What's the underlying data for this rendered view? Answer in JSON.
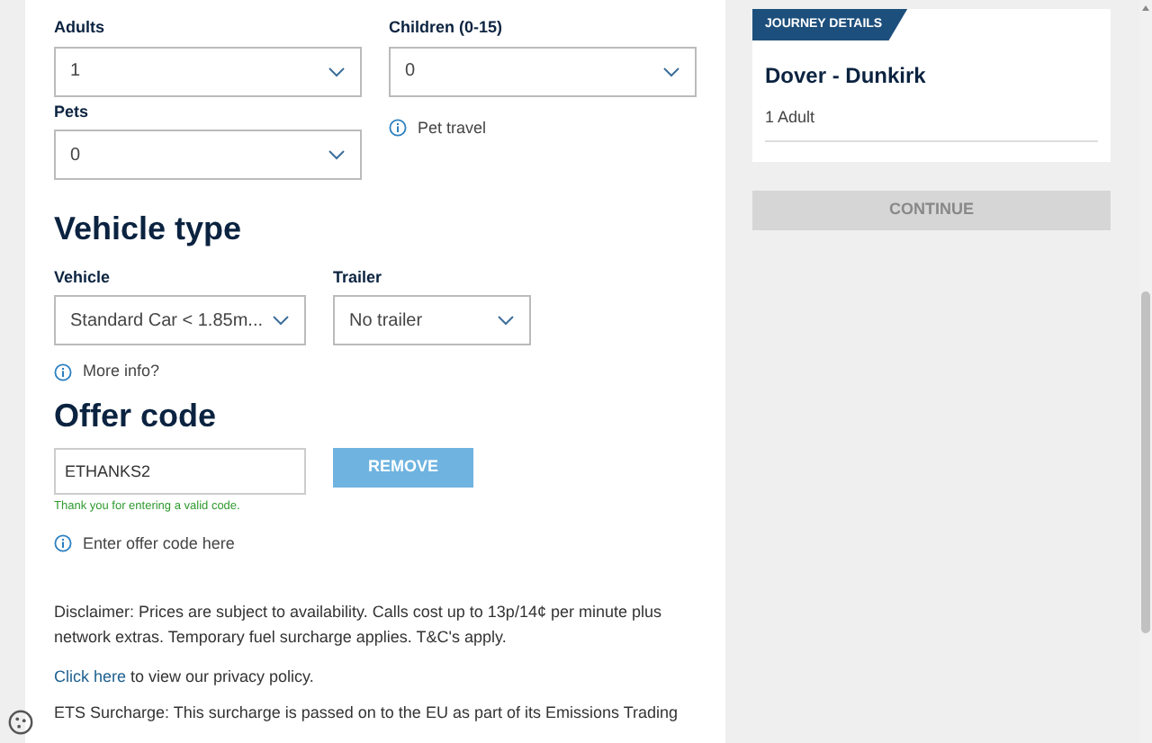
{
  "passengers": [
    {
      "label": "Adults",
      "value": "1"
    },
    {
      "label": "Children (0-15)",
      "value": "0"
    },
    {
      "label": "Pets",
      "value": "0"
    }
  ],
  "pet_travel": "Pet travel",
  "vehicle": {
    "heading": "Vehicle type",
    "fields": [
      {
        "label": "Vehicle",
        "value": "Standard Car < 1.85m..."
      },
      {
        "label": "Trailer",
        "value": "No trailer"
      }
    ],
    "info": "More info?"
  },
  "offer": {
    "heading": "Offer code",
    "value": "ETHANKS2",
    "button": "REMOVE",
    "message": "Thank you for entering a valid code.",
    "info": "Enter offer code here"
  },
  "disclaimer": "Disclaimer: Prices are subject to availability. Calls cost up to 13p/14¢ per minute plus network extras. Temporary fuel surcharge applies. T&C's apply.",
  "privacy": {
    "link": "Click here",
    "text": " to view our privacy policy."
  },
  "ets": "ETS Surcharge: This surcharge is passed on to the EU as part of its Emissions Trading",
  "journey": {
    "badge": "JOURNEY DETAILS",
    "route": "Dover - Dunkirk",
    "passengers": "1 Adult"
  },
  "continue": {
    "label": "CONTINUE",
    "disabled": true
  }
}
